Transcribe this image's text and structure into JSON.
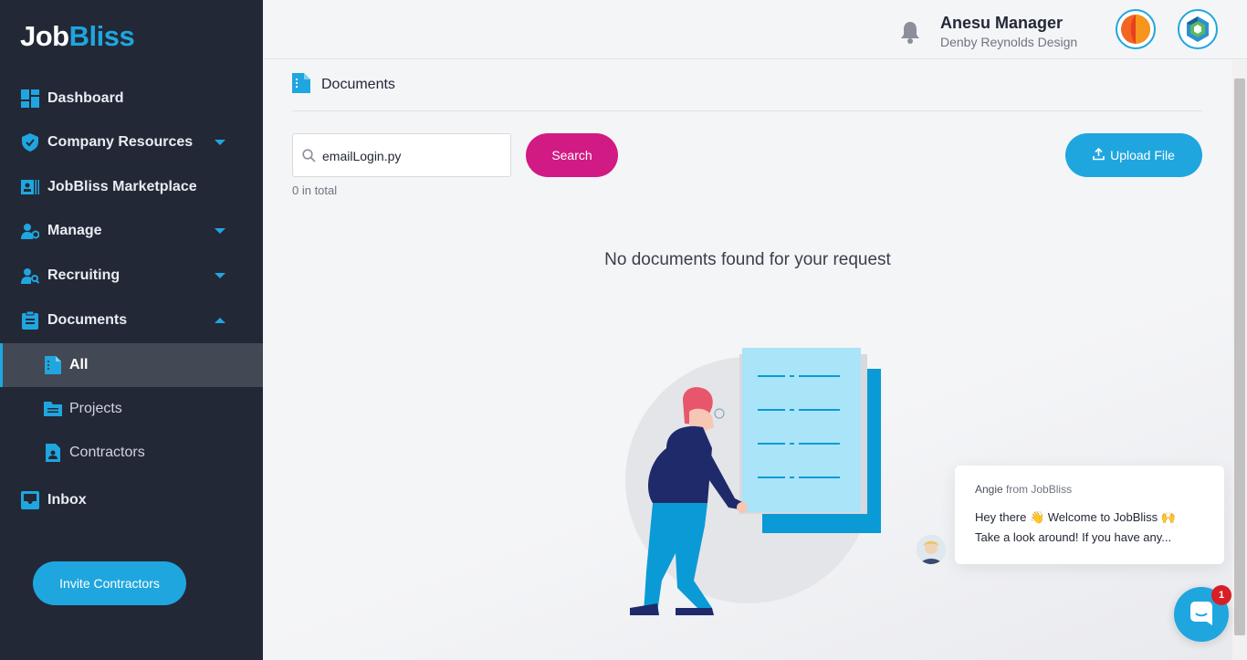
{
  "brand": {
    "logo_part1": "Job",
    "logo_part2": "Bliss"
  },
  "sidebar": {
    "items": [
      {
        "label": "Dashboard"
      },
      {
        "label": "Company Resources"
      },
      {
        "label": "JobBliss Marketplace"
      },
      {
        "label": "Manage"
      },
      {
        "label": "Recruiting"
      },
      {
        "label": "Documents"
      },
      {
        "label": "Inbox"
      }
    ],
    "documents_sub": [
      {
        "label": "All"
      },
      {
        "label": "Projects"
      },
      {
        "label": "Contractors"
      }
    ],
    "invite_label": "Invite Contractors"
  },
  "header": {
    "user_name": "Anesu Manager",
    "company": "Denby Reynolds Design"
  },
  "main": {
    "page_title": "Documents",
    "search_value": "emailLogin.py",
    "search_button": "Search",
    "upload_button": "Upload File",
    "total_text": "0 in total",
    "empty_message": "No documents found for your request"
  },
  "chat": {
    "sender_name": "Angie",
    "sender_suffix": "from JobBliss",
    "line1": "Hey there 👋 Welcome to JobBliss 🙌",
    "line2": "Take a look around! If you have any...",
    "badge_count": "1"
  },
  "colors": {
    "sidebar_bg": "#232837",
    "accent_blue": "#1fa6df",
    "search_pink": "#d11a83",
    "badge_red": "#d71f26"
  }
}
